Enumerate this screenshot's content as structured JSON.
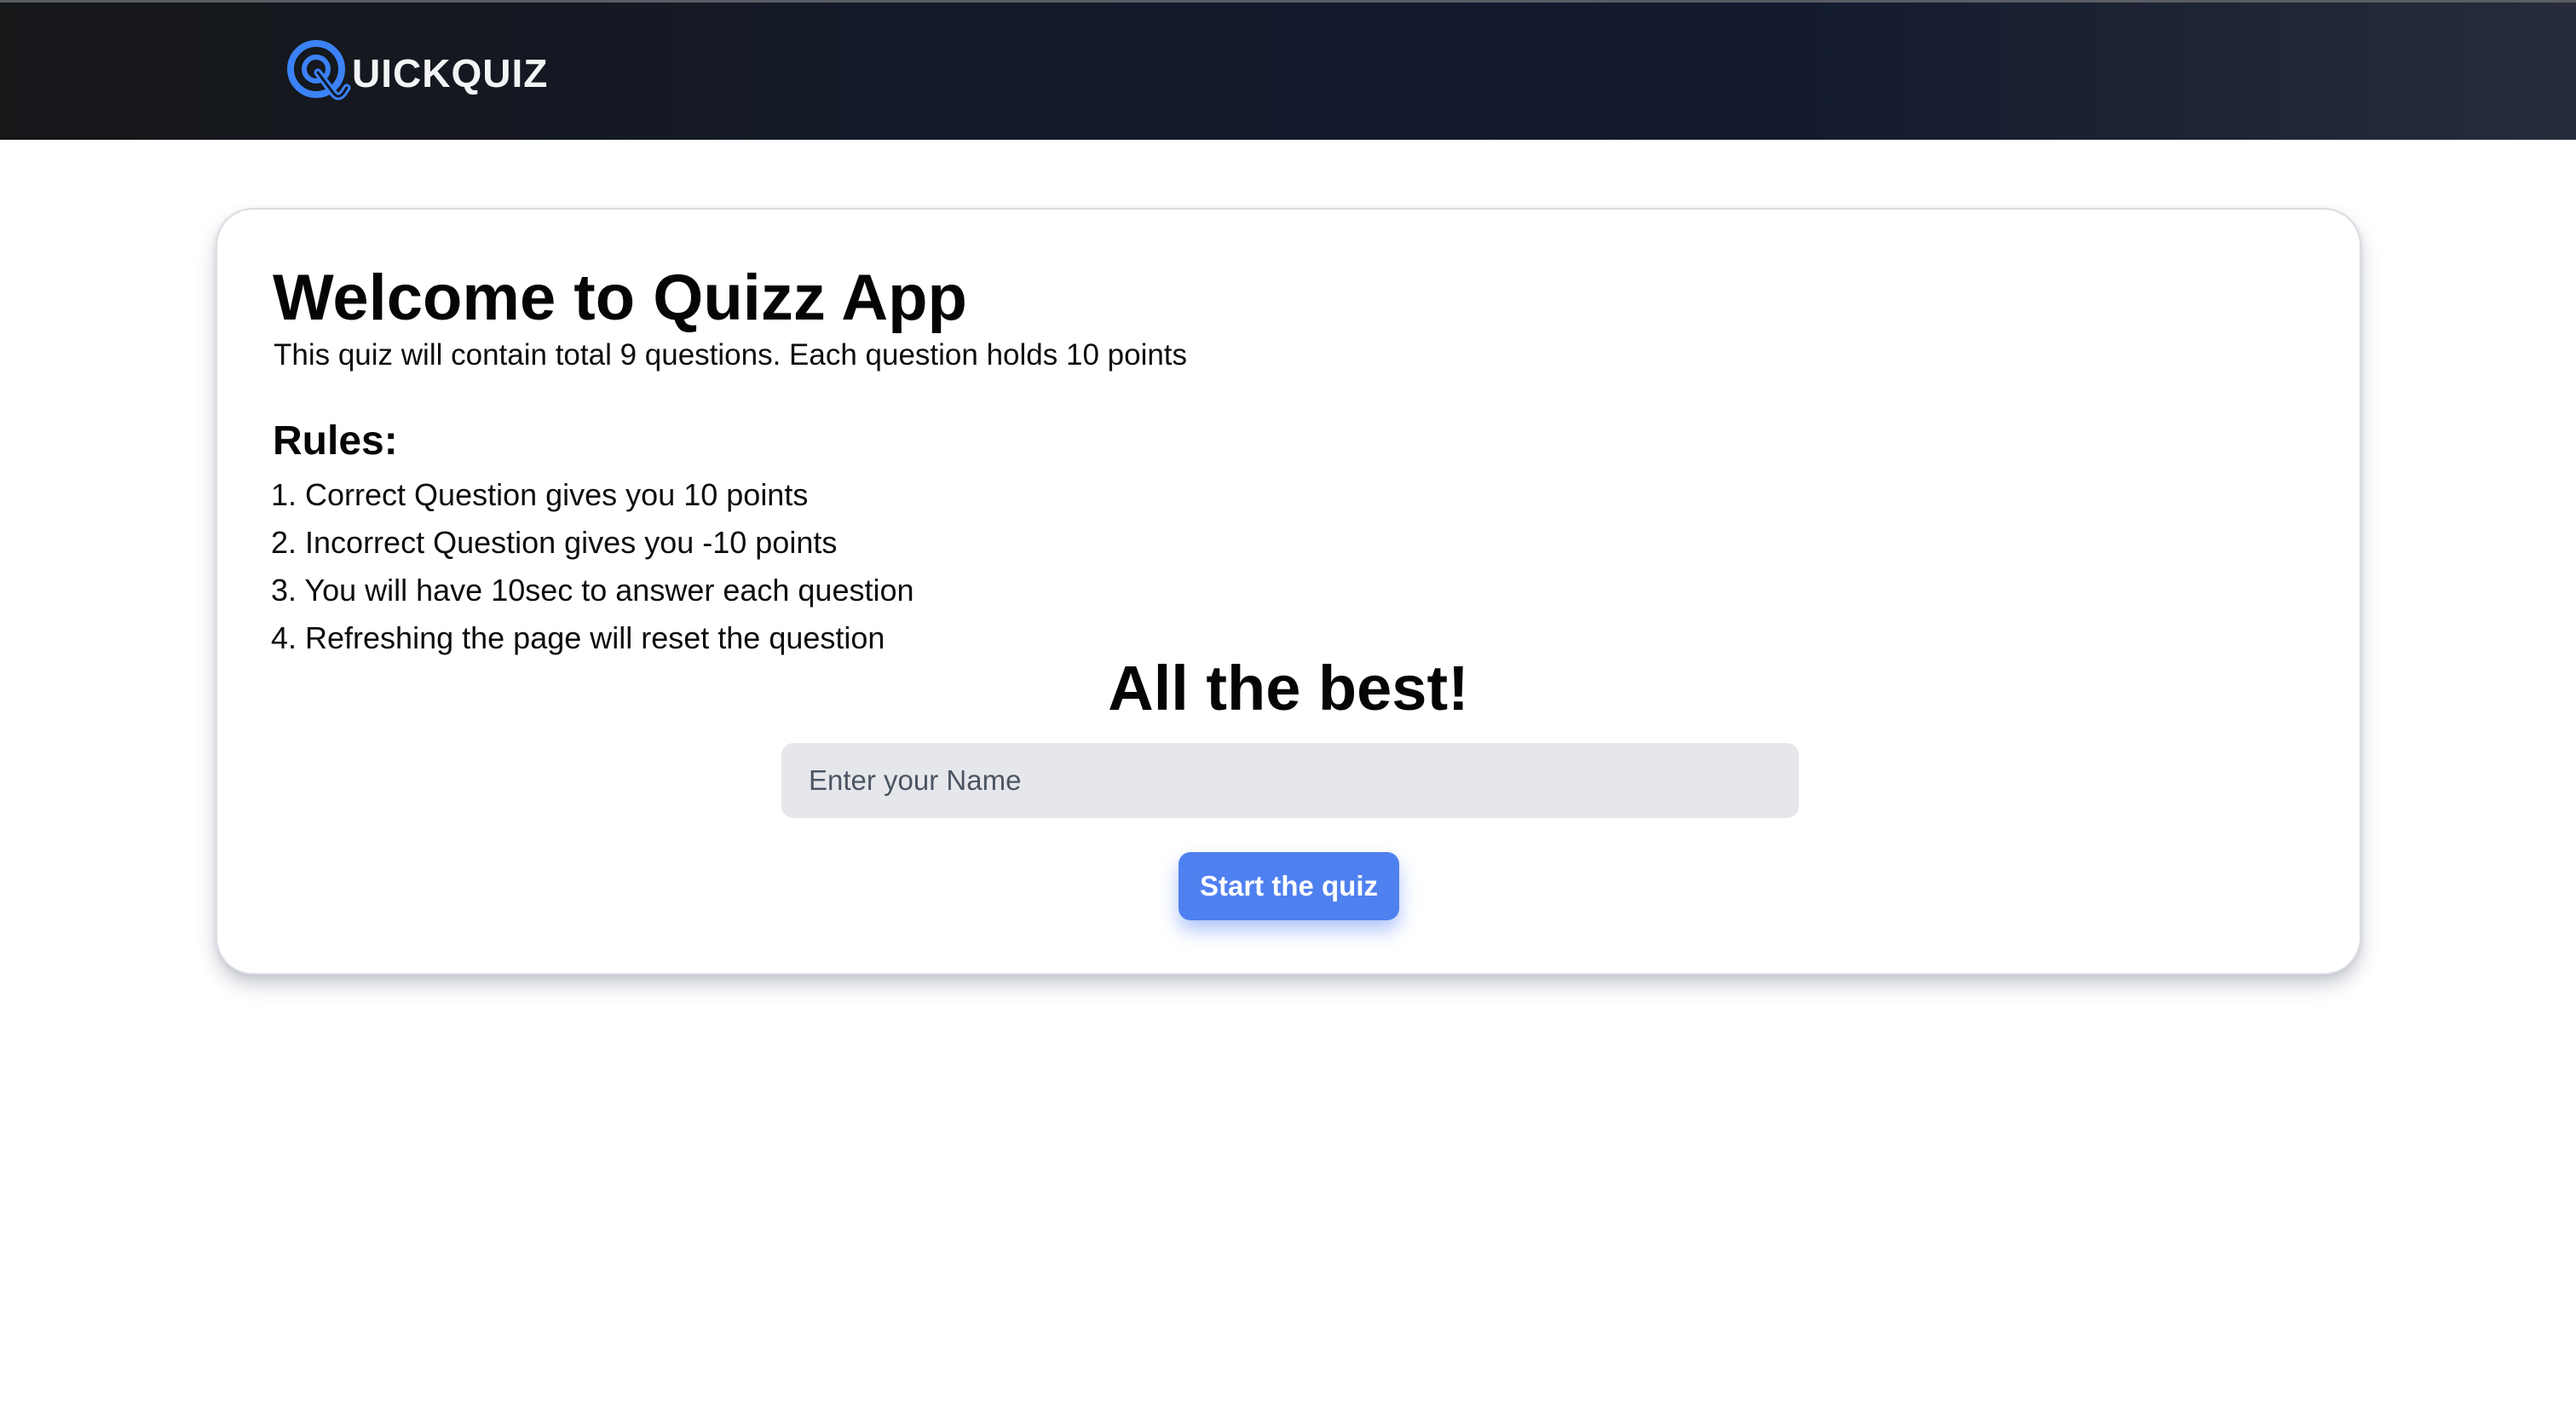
{
  "header": {
    "brand_text": "UICKQUIZ",
    "logo_icon": "quickquiz-q-logo-icon",
    "logo_color": "#3b82f6"
  },
  "main": {
    "title": "Welcome to Quizz App",
    "intro": "This quiz will contain total 9 questions. Each question holds 10 points",
    "rules_heading": "Rules:",
    "rules": [
      "1. Correct Question gives you 10 points",
      "2. Incorrect Question gives you -10 points",
      "3. You will have 10sec to answer each question",
      "4. Refreshing the page will reset the question"
    ],
    "best_wishes": "All the best!",
    "name_input": {
      "placeholder": "Enter your Name",
      "value": ""
    },
    "start_button_label": "Start the quiz"
  },
  "colors": {
    "accent": "#4f80f0",
    "navbar": "#131a2c",
    "input_background": "#e5e7eb"
  }
}
